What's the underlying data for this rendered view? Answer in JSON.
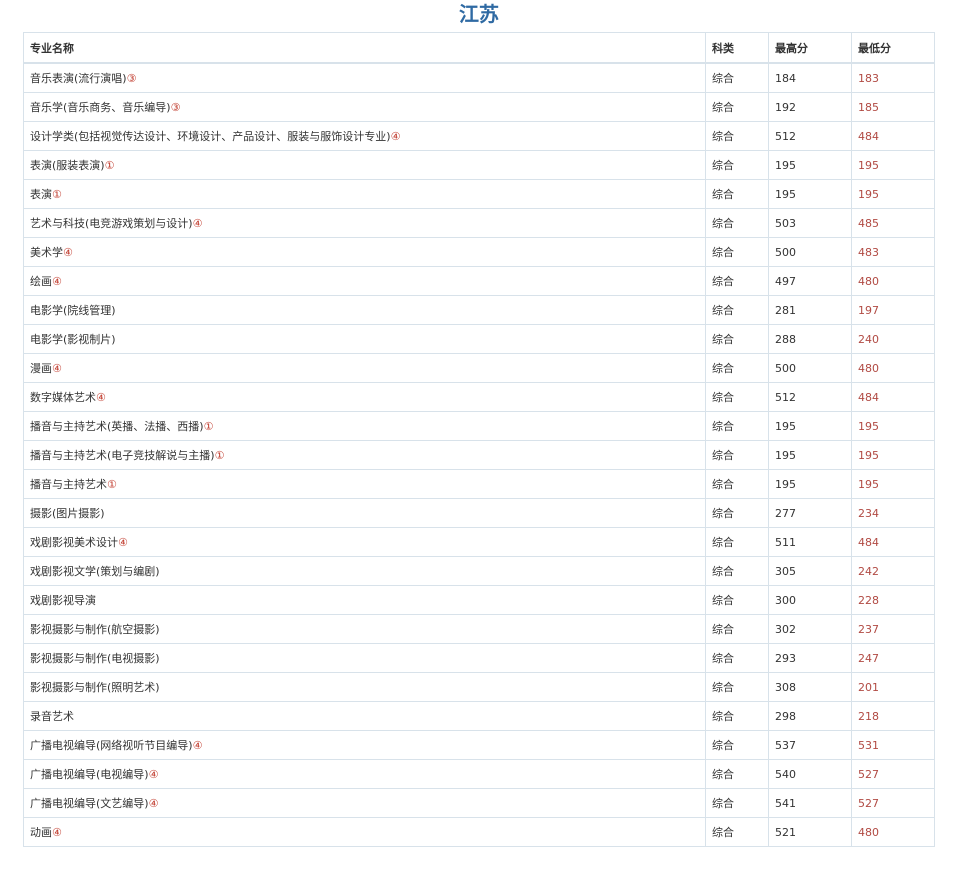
{
  "title": "江苏",
  "headers": {
    "major": "专业名称",
    "category": "科类",
    "max": "最高分",
    "min": "最低分"
  },
  "rows": [
    {
      "major": "音乐表演(流行演唱)",
      "mark": "③",
      "category": "综合",
      "max": "184",
      "min": "183"
    },
    {
      "major": "音乐学(音乐商务、音乐编导)",
      "mark": "③",
      "category": "综合",
      "max": "192",
      "min": "185"
    },
    {
      "major": "设计学类(包括视觉传达设计、环境设计、产品设计、服装与服饰设计专业)",
      "mark": "④",
      "category": "综合",
      "max": "512",
      "min": "484"
    },
    {
      "major": "表演(服装表演)",
      "mark": "①",
      "category": "综合",
      "max": "195",
      "min": "195"
    },
    {
      "major": "表演",
      "mark": "①",
      "category": "综合",
      "max": "195",
      "min": "195"
    },
    {
      "major": "艺术与科技(电竞游戏策划与设计)",
      "mark": "④",
      "category": "综合",
      "max": "503",
      "min": "485"
    },
    {
      "major": "美术学",
      "mark": "④",
      "category": "综合",
      "max": "500",
      "min": "483"
    },
    {
      "major": "绘画",
      "mark": "④",
      "category": "综合",
      "max": "497",
      "min": "480"
    },
    {
      "major": "电影学(院线管理)",
      "mark": "",
      "category": "综合",
      "max": "281",
      "min": "197"
    },
    {
      "major": "电影学(影视制片)",
      "mark": "",
      "category": "综合",
      "max": "288",
      "min": "240"
    },
    {
      "major": "漫画",
      "mark": "④",
      "category": "综合",
      "max": "500",
      "min": "480"
    },
    {
      "major": "数字媒体艺术",
      "mark": "④",
      "category": "综合",
      "max": "512",
      "min": "484"
    },
    {
      "major": "播音与主持艺术(英播、法播、西播)",
      "mark": "①",
      "category": "综合",
      "max": "195",
      "min": "195"
    },
    {
      "major": "播音与主持艺术(电子竞技解说与主播)",
      "mark": "①",
      "category": "综合",
      "max": "195",
      "min": "195"
    },
    {
      "major": "播音与主持艺术",
      "mark": "①",
      "category": "综合",
      "max": "195",
      "min": "195"
    },
    {
      "major": "摄影(图片摄影)",
      "mark": "",
      "category": "综合",
      "max": "277",
      "min": "234"
    },
    {
      "major": "戏剧影视美术设计",
      "mark": "④",
      "category": "综合",
      "max": "511",
      "min": "484"
    },
    {
      "major": "戏剧影视文学(策划与编剧)",
      "mark": "",
      "category": "综合",
      "max": "305",
      "min": "242"
    },
    {
      "major": "戏剧影视导演",
      "mark": "",
      "category": "综合",
      "max": "300",
      "min": "228"
    },
    {
      "major": "影视摄影与制作(航空摄影)",
      "mark": "",
      "category": "综合",
      "max": "302",
      "min": "237"
    },
    {
      "major": "影视摄影与制作(电视摄影)",
      "mark": "",
      "category": "综合",
      "max": "293",
      "min": "247"
    },
    {
      "major": "影视摄影与制作(照明艺术)",
      "mark": "",
      "category": "综合",
      "max": "308",
      "min": "201"
    },
    {
      "major": "录音艺术",
      "mark": "",
      "category": "综合",
      "max": "298",
      "min": "218"
    },
    {
      "major": "广播电视编导(网络视听节目编导)",
      "mark": "④",
      "category": "综合",
      "max": "537",
      "min": "531"
    },
    {
      "major": "广播电视编导(电视编导)",
      "mark": "④",
      "category": "综合",
      "max": "540",
      "min": "527"
    },
    {
      "major": "广播电视编导(文艺编导)",
      "mark": "④",
      "category": "综合",
      "max": "541",
      "min": "527"
    },
    {
      "major": "动画",
      "mark": "④",
      "category": "综合",
      "max": "521",
      "min": "480"
    }
  ]
}
